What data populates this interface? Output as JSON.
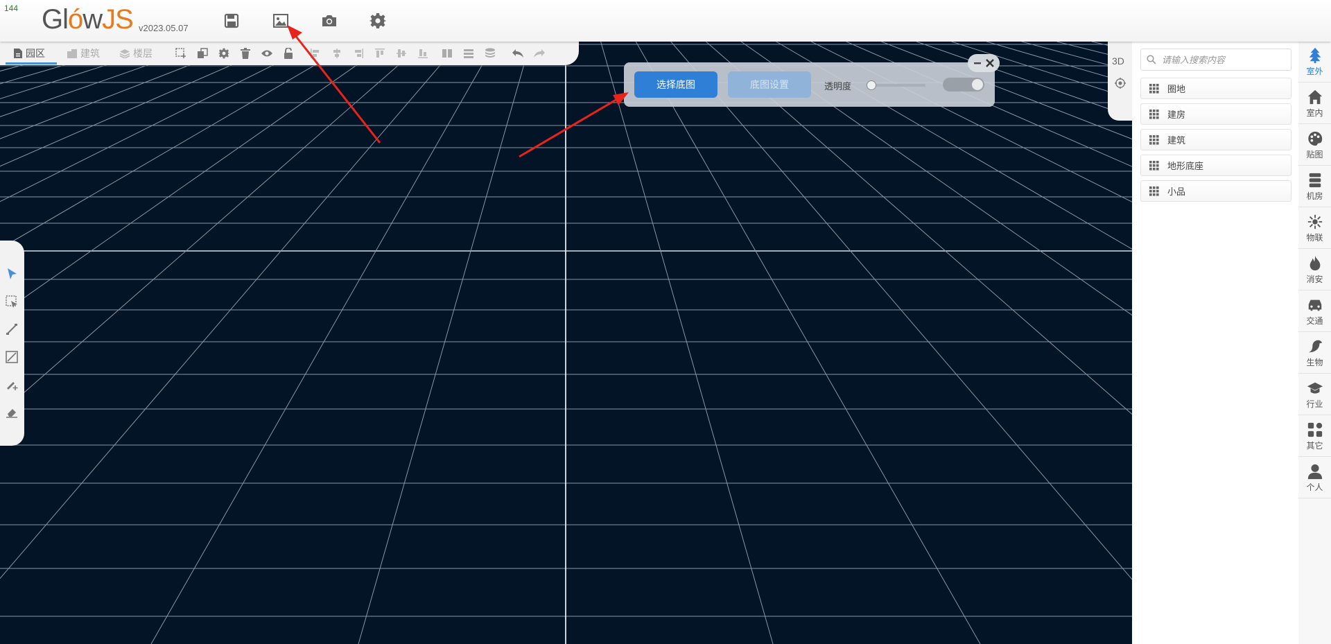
{
  "header": {
    "fps": "144",
    "logo_glow": "Gl",
    "logo_glow2": "w",
    "logo_js": "JS",
    "version": "v2023.05.07",
    "icons": [
      "save-icon",
      "image-icon",
      "camera-icon",
      "gear-icon"
    ]
  },
  "toolbar": {
    "tabs": [
      {
        "label": "园区",
        "active": true
      },
      {
        "label": "建筑",
        "active": false
      },
      {
        "label": "楼层",
        "active": false
      }
    ]
  },
  "dialog": {
    "select_button": "选择底图",
    "settings_button": "底图设置",
    "opacity_label": "透明度",
    "opacity_value": 0
  },
  "mini_panel": {
    "view_mode": "3D"
  },
  "library": {
    "search_placeholder": "请输入搜索内容",
    "items": [
      "圈地",
      "建房",
      "建筑",
      "地形底座",
      "小品"
    ]
  },
  "categories": [
    {
      "label": "室外",
      "icon": "tree-icon",
      "active": true
    },
    {
      "label": "室内",
      "icon": "house-icon",
      "active": false
    },
    {
      "label": "贴图",
      "icon": "palette-icon",
      "active": false
    },
    {
      "label": "机房",
      "icon": "server-icon",
      "active": false
    },
    {
      "label": "物联",
      "icon": "iot-icon",
      "active": false
    },
    {
      "label": "消安",
      "icon": "fire-icon",
      "active": false
    },
    {
      "label": "交通",
      "icon": "car-icon",
      "active": false
    },
    {
      "label": "生物",
      "icon": "bird-icon",
      "active": false
    },
    {
      "label": "行业",
      "icon": "graduation-cap-icon",
      "active": false
    },
    {
      "label": "其它",
      "icon": "shapes-icon",
      "active": false
    },
    {
      "label": "个人",
      "icon": "user-icon",
      "active": false
    }
  ],
  "colors": {
    "grid_background": "#021426",
    "accent": "#2f7fd6",
    "logo_orange": "#e87a1e",
    "arrow_red": "#e8231c"
  }
}
